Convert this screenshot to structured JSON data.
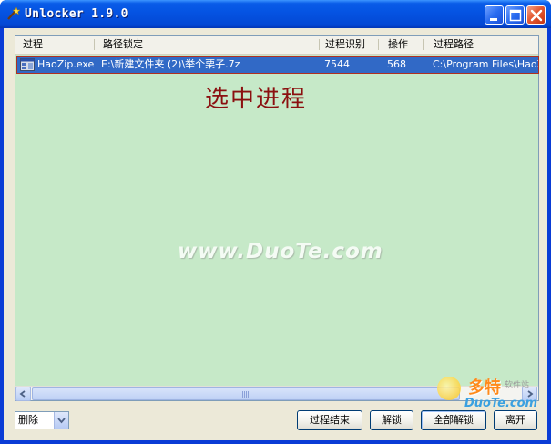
{
  "window": {
    "title": "Unlocker 1.9.0",
    "icons": {
      "app": "wand-icon",
      "minimize": "minimize-icon",
      "maximize": "maximize-icon",
      "close": "close-icon"
    }
  },
  "list": {
    "columns": [
      "过程",
      "路径锁定",
      "过程识别",
      "操作",
      "过程路径"
    ],
    "rows": [
      {
        "icon": "executable-icon",
        "process": "HaoZip.exe",
        "path_locked": "E:\\新建文件夹 (2)\\举个栗子.7z",
        "pid": "7544",
        "handle": "568",
        "process_path": "C:\\Program Files\\HaoZip"
      }
    ],
    "annotation": "选中进程",
    "watermark": "www.DuoTe.com"
  },
  "action_select": {
    "value": "删除"
  },
  "buttons": {
    "kill_process": "过程结束",
    "unlock": "解锁",
    "unlock_all": "全部解锁",
    "quit": "离开"
  },
  "logo": {
    "text": "多特",
    "sub": "软件站",
    "sub2": "DuoTe.com"
  },
  "colors": {
    "title_bar": "#0554e3",
    "list_background": "#c6e9c8",
    "selection": "#3169c6",
    "annotation": "#8b1010"
  }
}
